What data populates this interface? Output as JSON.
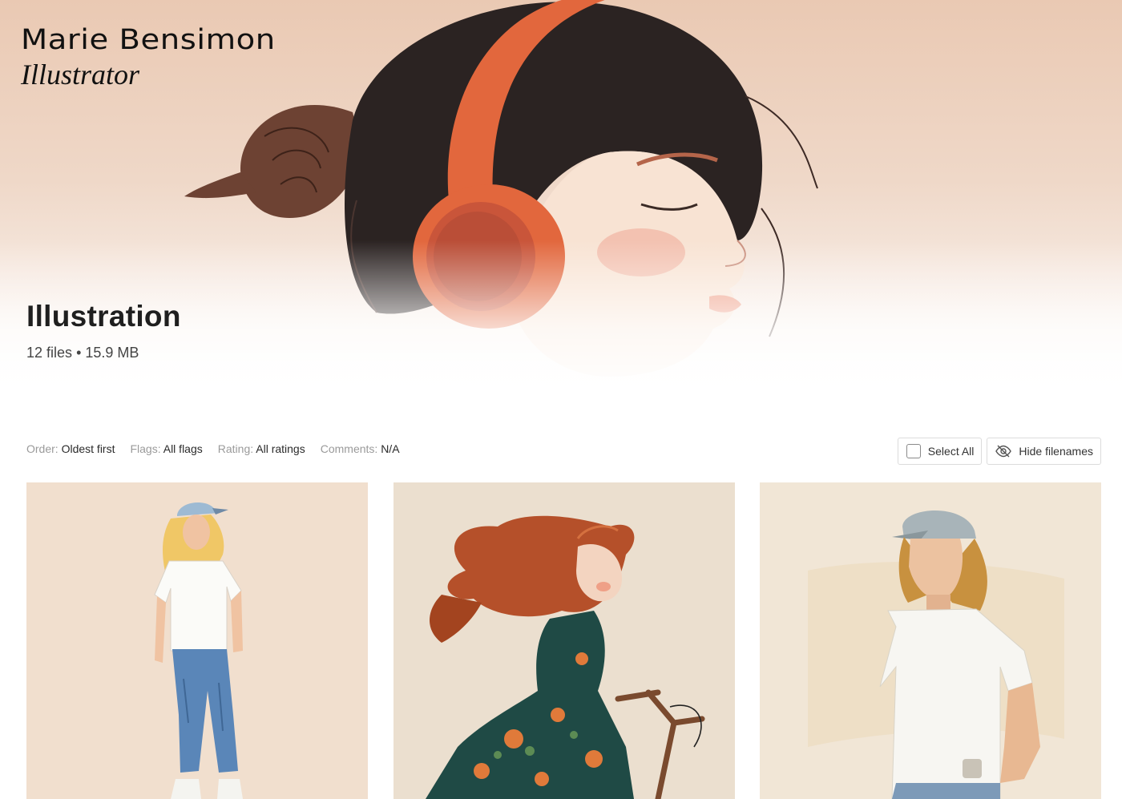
{
  "brand": {
    "name": "Marie Bensimon",
    "role": "Illustrator"
  },
  "gallery": {
    "title": "Illustration",
    "file_count": "12 files",
    "separator": "•",
    "size": "15.9 MB"
  },
  "filters": [
    {
      "label": "Order:",
      "value": "Oldest first"
    },
    {
      "label": "Flags:",
      "value": "All flags"
    },
    {
      "label": "Rating:",
      "value": "All ratings"
    },
    {
      "label": "Comments:",
      "value": "N/A"
    }
  ],
  "actions": {
    "select_all": "Select All",
    "hide_filenames": "Hide filenames"
  },
  "photos": [
    {
      "icon": "illustration-man-long-hair-cap-standing"
    },
    {
      "icon": "illustration-woman-red-hair-bicycle"
    },
    {
      "icon": "illustration-man-cap-white-tshirt"
    }
  ],
  "colors": {
    "hero_top": "#eac9b3",
    "headphones": "#e2673d",
    "hair_dark": "#2b2322",
    "hair_brown": "#6b3e2e",
    "text_dark": "#1f1f1f",
    "label_gray": "#9a9a9a"
  }
}
